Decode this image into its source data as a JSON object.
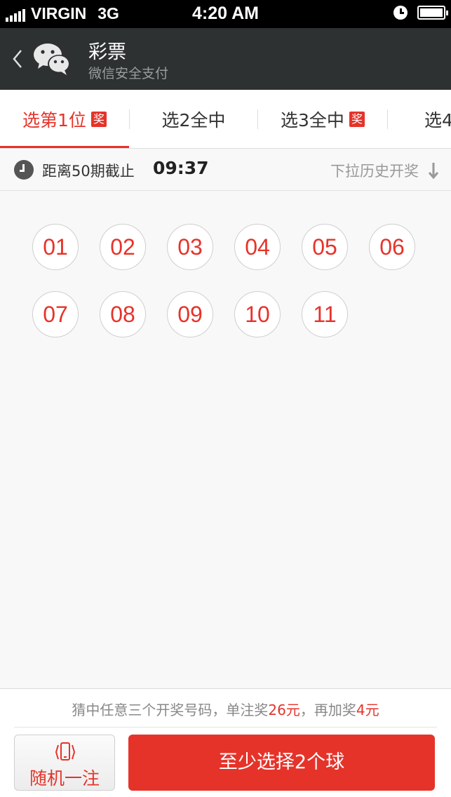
{
  "status_bar": {
    "carrier": "VIRGIN",
    "network": "3G",
    "time": "4:20 AM",
    "icons": [
      "signal-icon",
      "alarm-icon",
      "battery-icon"
    ]
  },
  "header": {
    "back_icon": "chevron-left-icon",
    "logo_icon": "wechat-icon",
    "title": "彩票",
    "subtitle": "微信安全支付"
  },
  "tabs": [
    {
      "label": "选第1位",
      "badge": "奖",
      "active": true
    },
    {
      "label": "选2全中",
      "badge": "",
      "active": false
    },
    {
      "label": "选3全中",
      "badge": "奖",
      "active": false
    },
    {
      "label": "选4",
      "badge": "",
      "active": false
    }
  ],
  "deadline": {
    "icon": "clock-icon",
    "label": "距离50期截止",
    "countdown": "09:37",
    "history_label": "下拉历史开奖",
    "history_icon": "arrow-down-icon"
  },
  "balls": [
    "01",
    "02",
    "03",
    "04",
    "05",
    "06",
    "07",
    "08",
    "09",
    "10",
    "11"
  ],
  "footer": {
    "hint_prefix": "猜中任意三个开奖号码，单注奖",
    "hint_amount1": "26元",
    "hint_middle": "，再加奖",
    "hint_amount2": "4元",
    "random_icon": "phone-shake-icon",
    "random_label": "随机一注",
    "submit_label": "至少选择2个球"
  },
  "colors": {
    "accent": "#e6332a",
    "header_bg": "#2e3132",
    "page_bg": "#f8f8f8"
  }
}
